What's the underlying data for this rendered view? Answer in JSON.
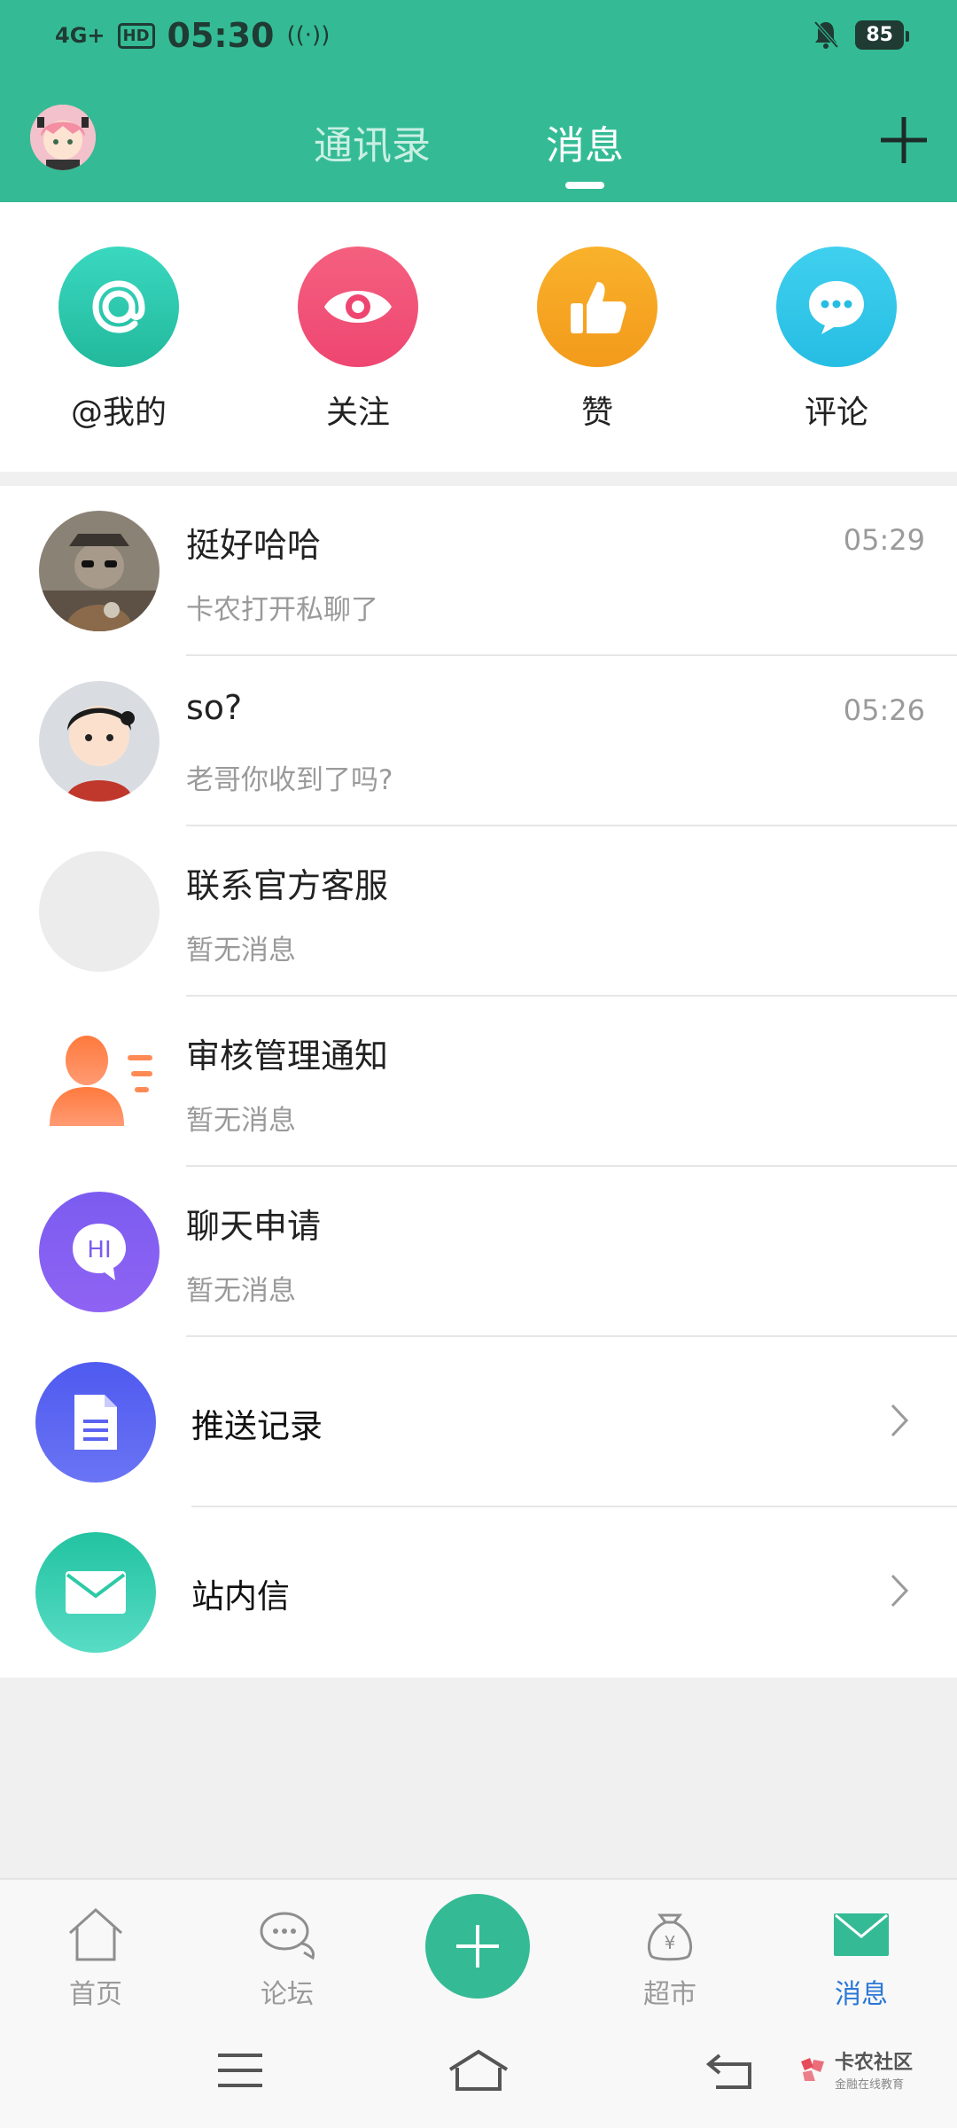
{
  "status_bar": {
    "network": "4G+",
    "hd": "HD",
    "time": "05:30",
    "battery": "85"
  },
  "header": {
    "tabs": [
      {
        "label": "通讯录",
        "active": false
      },
      {
        "label": "消息",
        "active": true
      }
    ]
  },
  "shortcuts": [
    {
      "label": "@我的",
      "icon": "at-icon",
      "color": "#2ec9b0"
    },
    {
      "label": "关注",
      "icon": "eye-icon",
      "color": "#f2557a"
    },
    {
      "label": "赞",
      "icon": "thumbs-up-icon",
      "color": "#f7a623"
    },
    {
      "label": "评论",
      "icon": "chat-bubble-icon",
      "color": "#33c6ea"
    }
  ],
  "conversations": [
    {
      "name": "挺好哈哈",
      "preview": "卡农打开私聊了",
      "time": "05:29"
    },
    {
      "name": "so?",
      "preview": "老哥你收到了吗?",
      "time": "05:26"
    },
    {
      "name": "联系官方客服",
      "preview": "暂无消息",
      "time": ""
    },
    {
      "name": "审核管理通知",
      "preview": "暂无消息",
      "time": ""
    },
    {
      "name": "聊天申请",
      "preview": "暂无消息",
      "time": ""
    }
  ],
  "menu_rows": [
    {
      "title": "推送记录",
      "icon": "document-icon",
      "color": "#5b63f0"
    },
    {
      "title": "站内信",
      "icon": "mail-icon",
      "color": "#2ec9a6"
    }
  ],
  "bottom_nav": [
    {
      "label": "首页",
      "icon": "home-icon",
      "active": false
    },
    {
      "label": "论坛",
      "icon": "forum-icon",
      "active": false
    },
    {
      "label": "超市",
      "icon": "money-bag-icon",
      "active": false
    },
    {
      "label": "消息",
      "icon": "mail-icon",
      "active": true
    }
  ],
  "watermark": {
    "main": "卡农社区",
    "sub": "金融在线教育"
  },
  "colors": {
    "brand_green": "#34bb95",
    "active_blue": "#2b78d7"
  }
}
